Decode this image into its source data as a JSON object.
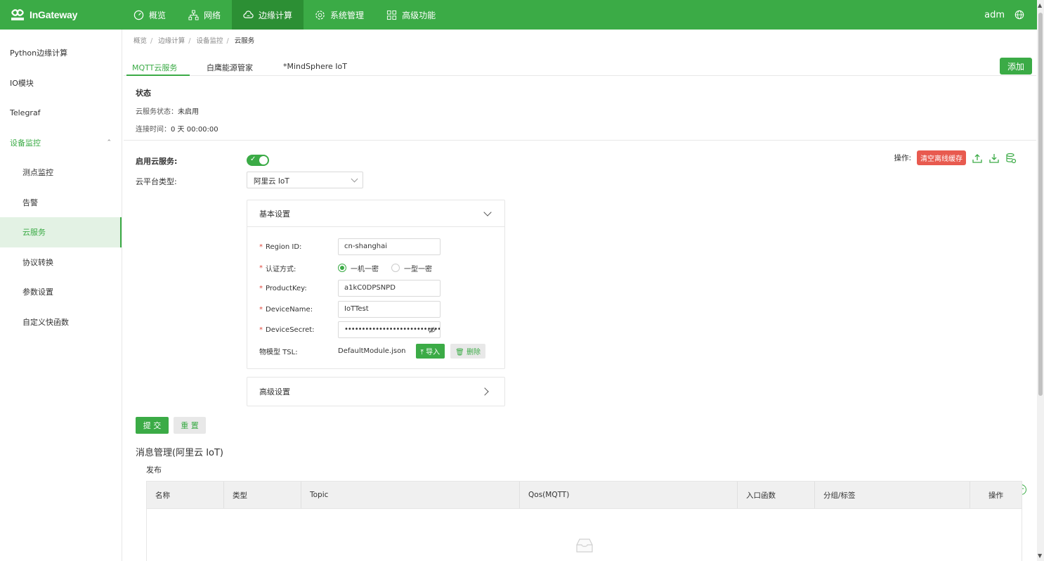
{
  "app": {
    "brand": "InGateway",
    "user": "adm"
  },
  "nav": [
    {
      "label": "概览",
      "icon": "dashboard-icon"
    },
    {
      "label": "网络",
      "icon": "network-icon"
    },
    {
      "label": "边缘计算",
      "icon": "cloud-icon",
      "active": true
    },
    {
      "label": "系统管理",
      "icon": "gear-icon"
    },
    {
      "label": "高级功能",
      "icon": "grid-icon"
    }
  ],
  "sidebar": [
    {
      "label": "Python边缘计算"
    },
    {
      "label": "IO模块"
    },
    {
      "label": "Telegraf"
    },
    {
      "label": "设备监控"
    },
    {
      "label": "测点监控"
    },
    {
      "label": "告警"
    },
    {
      "label": "云服务"
    },
    {
      "label": "协议转换"
    },
    {
      "label": "参数设置"
    },
    {
      "label": "自定义快函数"
    }
  ],
  "breadcrumb": [
    "概览",
    "边缘计算",
    "设备监控",
    "云服务"
  ],
  "tabs": [
    "MQTT云服务",
    "白鹰能源管家",
    "*MindSphere IoT"
  ],
  "add_button": "添加",
  "status": {
    "title": "状态",
    "service_label": "云服务状态：",
    "service_value": "未启用",
    "conn_label": "连接时间：",
    "conn_value": "0 天 00:00:00"
  },
  "form": {
    "enable_label": "启用云服务:",
    "enabled": true,
    "platform_label": "云平台类型:",
    "platform_value": "阿里云 IoT",
    "ops_label": "操作:",
    "clear_cache": "清空离线缓存"
  },
  "basic": {
    "title": "基本设置",
    "region_label": "Region ID:",
    "region_value": "cn-shanghai",
    "auth_label": "认证方式:",
    "auth_options": [
      "一机一密",
      "一型一密"
    ],
    "auth_selected": "一机一密",
    "product_label": "ProductKey:",
    "product_value": "a1kC0DPSNPD",
    "device_label": "DeviceName:",
    "device_value": "IoTTest",
    "secret_label": "DeviceSecret:",
    "secret_value": "••••••••••••••••••••••••••••",
    "tsl_label": "物模型 TSL:",
    "tsl_value": "DefaultModule.json",
    "import_label": "导入",
    "delete_label": "删除"
  },
  "advanced": {
    "title": "高级设置"
  },
  "actions": {
    "submit": "提 交",
    "reset": "重 置"
  },
  "messages": {
    "title": "消息管理(阿里云 IoT)",
    "publish_label": "发布",
    "columns": [
      "名称",
      "类型",
      "Topic",
      "Qos(MQTT)",
      "入口函数",
      "分组/标签",
      "操作"
    ]
  },
  "colors": {
    "primary": "#3bab46",
    "danger": "#e85a4f"
  }
}
